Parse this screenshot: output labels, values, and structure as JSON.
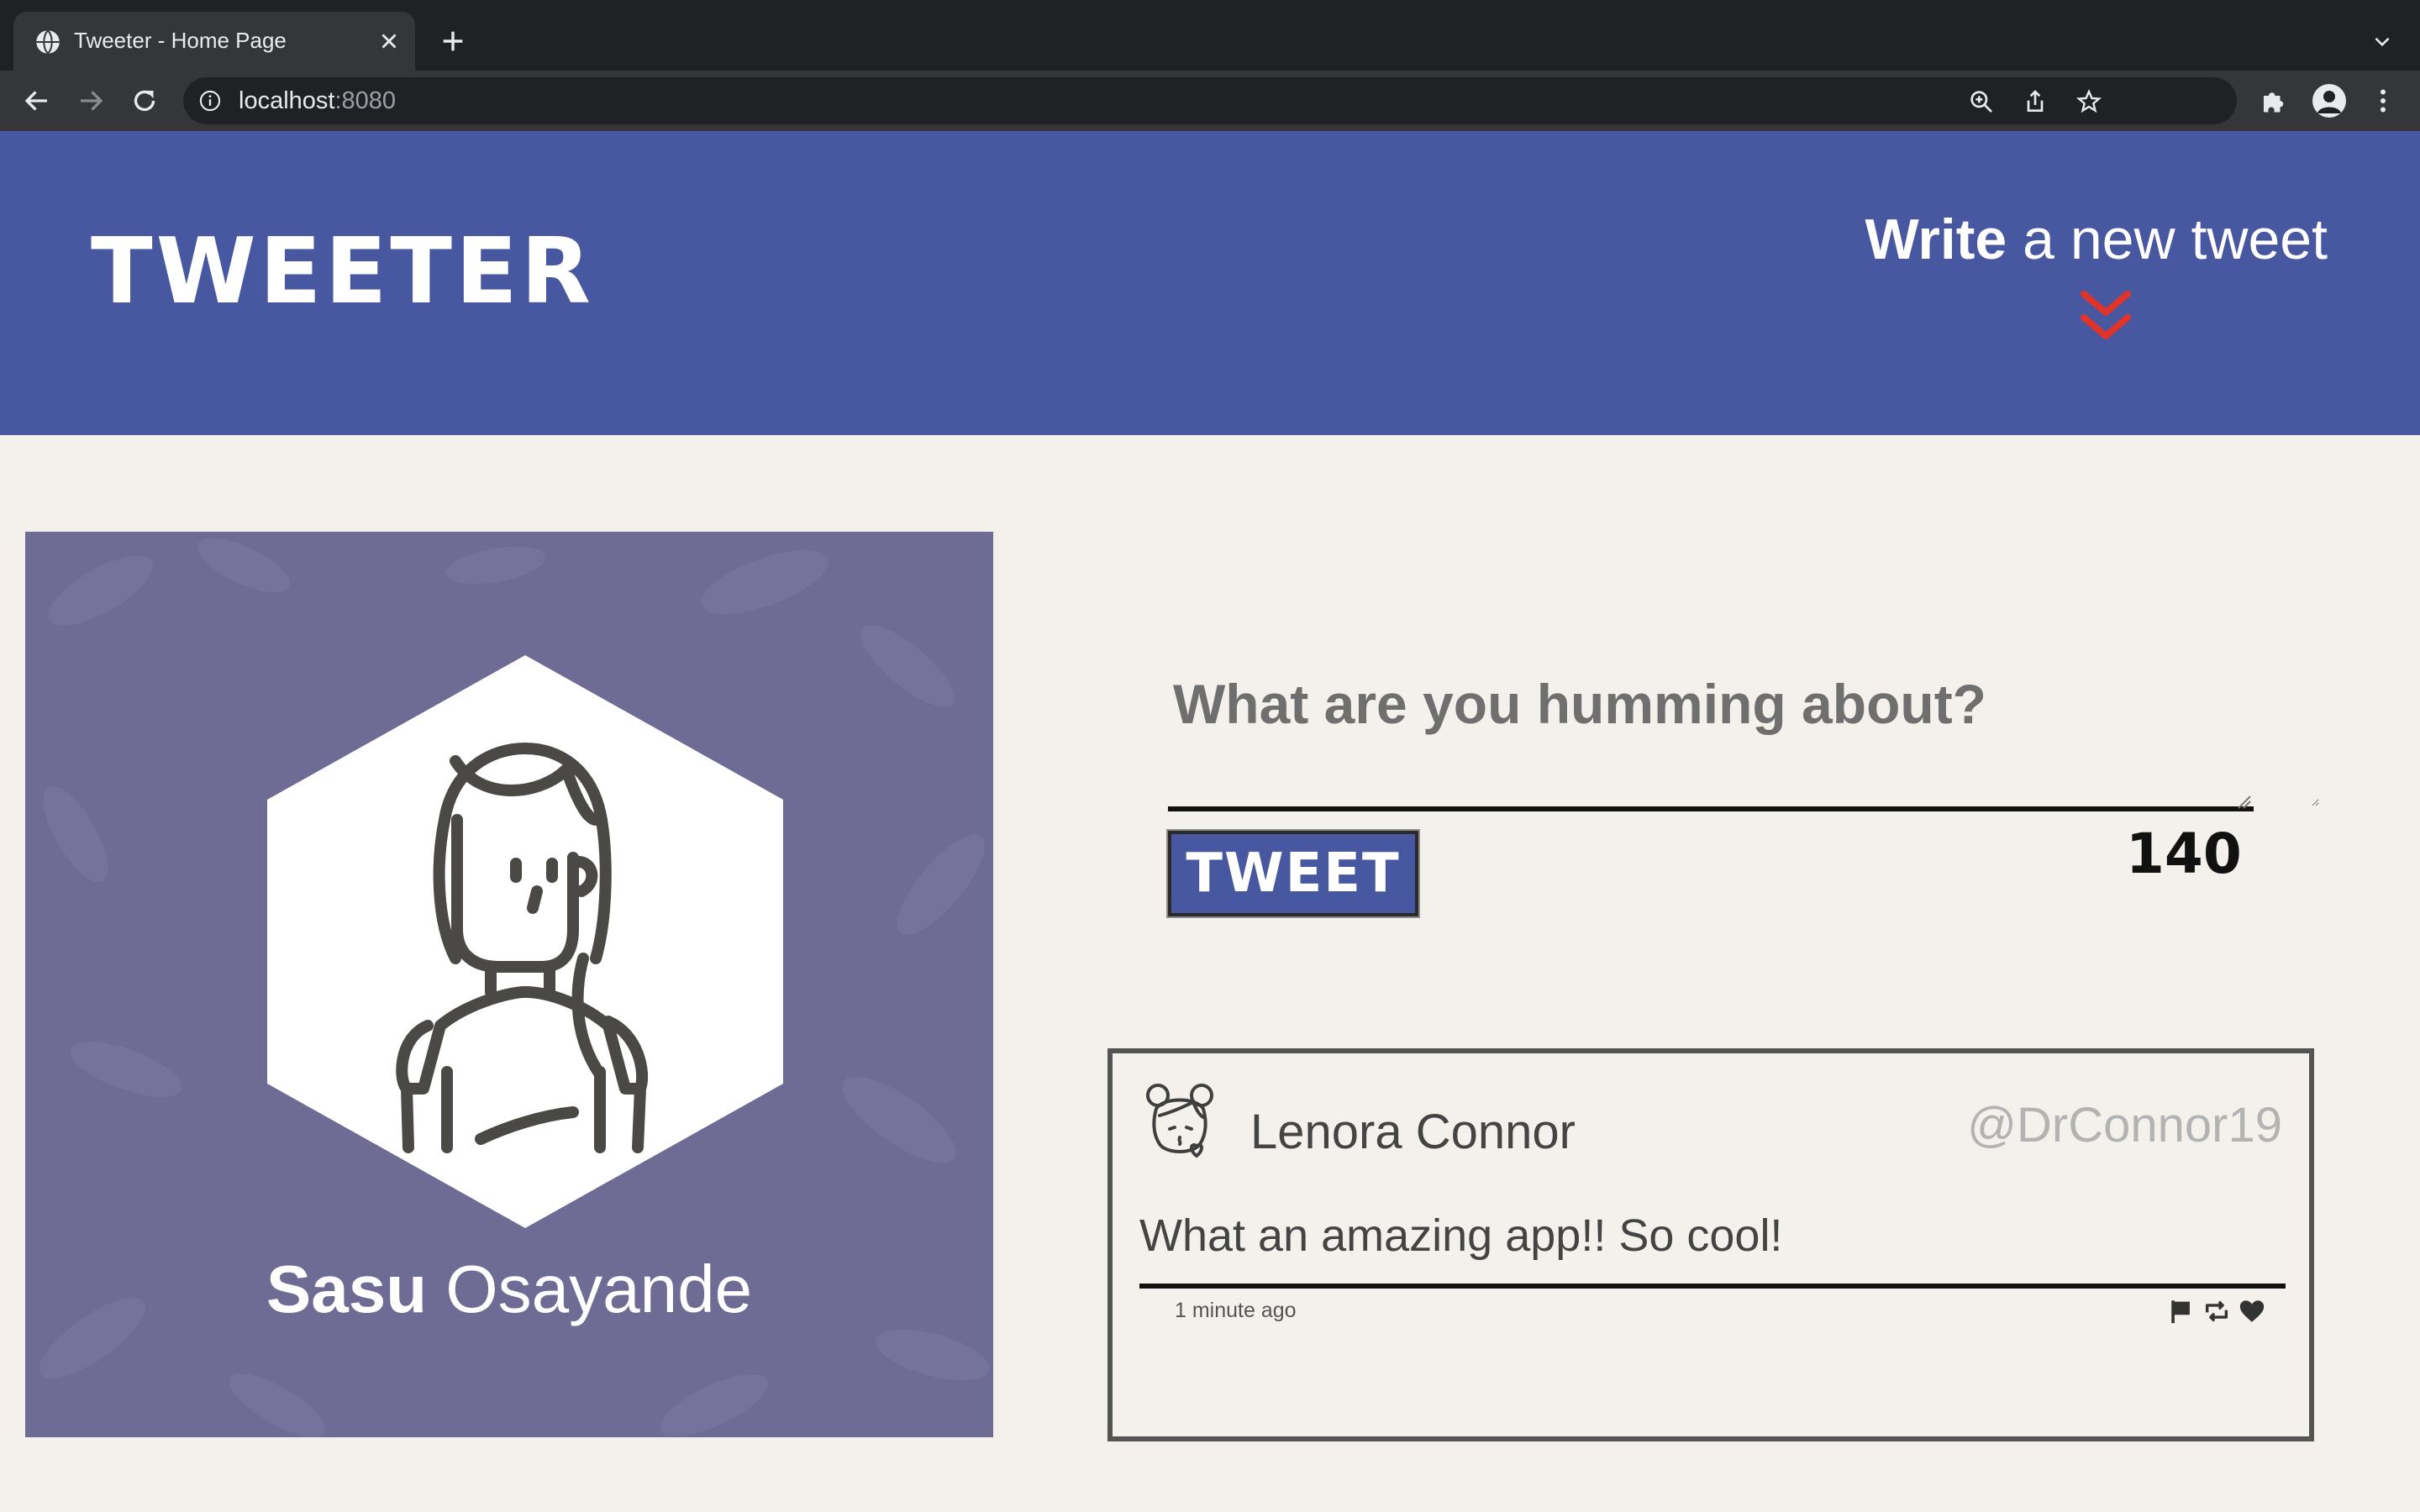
{
  "browser": {
    "tab_title": "Tweeter - Home Page",
    "url_host": "localhost",
    "url_port": ":8080",
    "icons": [
      "globe-icon",
      "close-icon",
      "plus-icon",
      "chevron-down-icon",
      "back-arrow-icon",
      "forward-arrow-icon",
      "reload-icon",
      "info-icon",
      "zoom-icon",
      "share-icon",
      "star-icon",
      "puzzle-icon",
      "profile-icon",
      "kebab-menu-icon"
    ]
  },
  "header": {
    "logo": "TWEETER",
    "write_bold": "Write",
    "write_rest": " a new tweet",
    "accent_color": "#e0342b",
    "background_color": "#4757a0"
  },
  "profile": {
    "first_name": "Sasu",
    "last_name": " Osayande"
  },
  "compose": {
    "placeholder": "What are you humming about?",
    "button_label": "TWEET",
    "char_count": "140"
  },
  "tweets": [
    {
      "author": "Lenora Connor",
      "handle": "@DrConnor19",
      "text": "What an amazing app!! So cool!",
      "timestamp": "1 minute ago",
      "actions": [
        "flag-icon",
        "retweet-icon",
        "heart-icon"
      ]
    }
  ]
}
